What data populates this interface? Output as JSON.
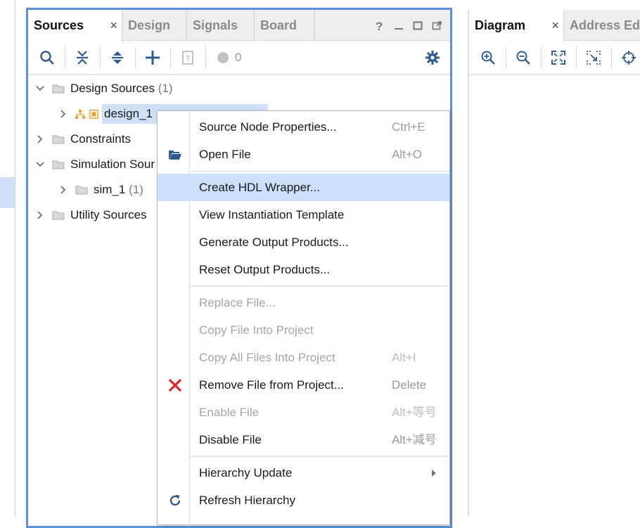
{
  "sources_panel": {
    "tabs": [
      {
        "label": "Sources",
        "active": true,
        "close": "×"
      },
      {
        "label": "Design"
      },
      {
        "label": "Signals"
      },
      {
        "label": "Board"
      }
    ],
    "window_controls": {
      "help": "?"
    },
    "toolbar": {
      "error_count": "0"
    },
    "tree": {
      "design_sources": {
        "label": "Design Sources",
        "count": "(1)"
      },
      "design_1_prefix": "design_1",
      "constraints": {
        "label": "Constraints"
      },
      "simulation_sources": {
        "label": "Simulation Sour"
      },
      "sim_1": {
        "label": "sim_1",
        "count": "(1)"
      },
      "utility_sources": {
        "label": "Utility Sources"
      }
    }
  },
  "diagram_panel": {
    "tabs": [
      {
        "label": "Diagram",
        "active": true,
        "close": "×"
      },
      {
        "label": "Address Edi"
      }
    ]
  },
  "context_menu": {
    "items": [
      {
        "label": "Source Node Properties...",
        "shortcut": "Ctrl+E"
      },
      {
        "label": "Open File",
        "shortcut": "Alt+O",
        "icon": "folder-open-icon"
      },
      {
        "label": "Create HDL Wrapper...",
        "highlighted": true
      },
      {
        "label": "View Instantiation Template"
      },
      {
        "label": "Generate Output Products..."
      },
      {
        "label": "Reset Output Products..."
      },
      {
        "label": "Replace File...",
        "disabled": true
      },
      {
        "label": "Copy File Into Project",
        "disabled": true
      },
      {
        "label": "Copy All Files Into Project",
        "shortcut": "Alt+I",
        "disabled": true
      },
      {
        "label": "Remove File from Project...",
        "shortcut": "Delete",
        "icon": "remove-x-icon"
      },
      {
        "label": "Enable File",
        "shortcut": "Alt+等号",
        "disabled": true
      },
      {
        "label": "Disable File",
        "shortcut": "Alt+减号"
      },
      {
        "label": "Hierarchy Update",
        "submenu": true
      },
      {
        "label": "Refresh Hierarchy",
        "icon": "refresh-icon"
      }
    ]
  },
  "colors": {
    "accent_border": "#5b8fd6",
    "highlight": "#cce0fb",
    "selection": "#cfe0f8",
    "remove_red": "#e0242b",
    "icon_blue": "#2f5c8f"
  }
}
